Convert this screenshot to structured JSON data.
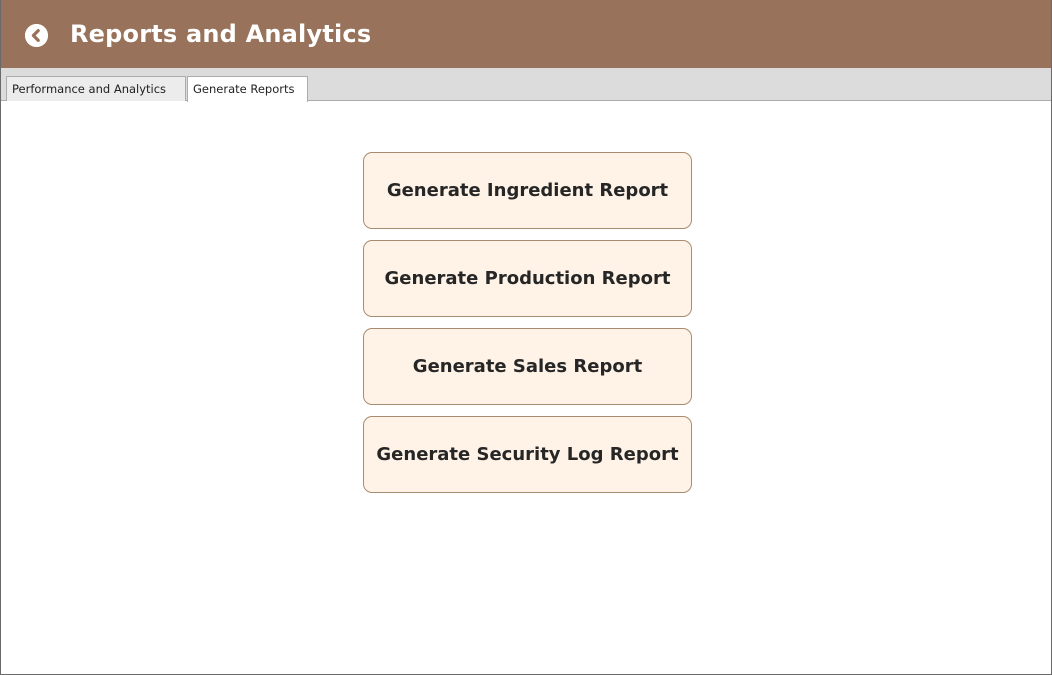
{
  "header": {
    "title": "Reports and Analytics",
    "back_icon": "back-arrow-circle-icon",
    "background_color": "#98725a"
  },
  "tabs": [
    {
      "label": "Performance and Analytics",
      "active": false
    },
    {
      "label": "Generate Reports",
      "active": true
    }
  ],
  "reports": {
    "ingredient_label": "Generate Ingredient Report",
    "production_label": "Generate Production Report",
    "sales_label": "Generate Sales Report",
    "security_log_label": "Generate Security Log Report"
  },
  "colors": {
    "button_fill": "#fff3e8",
    "button_border": "#a98b72"
  }
}
